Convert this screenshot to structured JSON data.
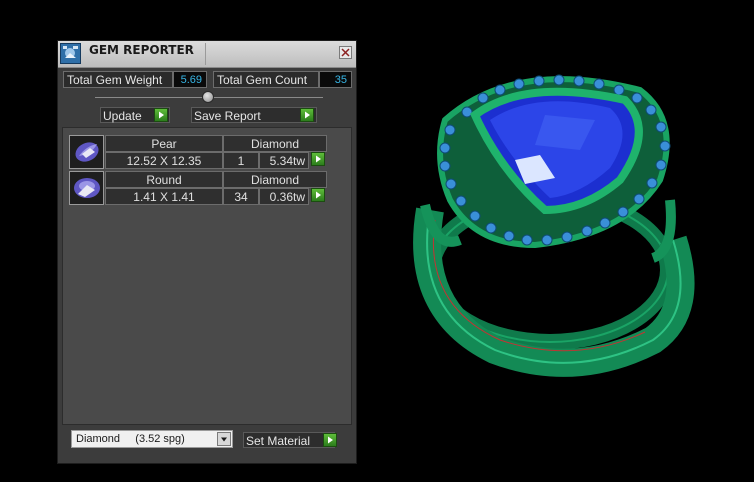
{
  "window": {
    "title": "GEM REPORTER",
    "close_label": "×"
  },
  "totals": {
    "weight_label": "Total Gem Weight",
    "weight_value": "5.69",
    "count_label": "Total Gem Count",
    "count_value": "35"
  },
  "toolbar": {
    "update_label": "Update",
    "save_report_label": "Save Report"
  },
  "gems": [
    {
      "shape": "Pear",
      "material": "Diamond",
      "size": "12.52 X 12.35",
      "count": "1",
      "weight": "5.34tw",
      "icon": "pear-gem-icon"
    },
    {
      "shape": "Round",
      "material": "Diamond",
      "size": "1.41 X 1.41",
      "count": "34",
      "weight": "0.36tw",
      "icon": "round-gem-icon"
    }
  ],
  "material": {
    "selected": "Diamond     (3.52 spg)",
    "set_label": "Set Material"
  },
  "colors": {
    "value_text": "#37b6e6",
    "play_green": "#3f9a26",
    "ring_green": "#1a8a57",
    "gem_blue": "#1c2fd0"
  }
}
